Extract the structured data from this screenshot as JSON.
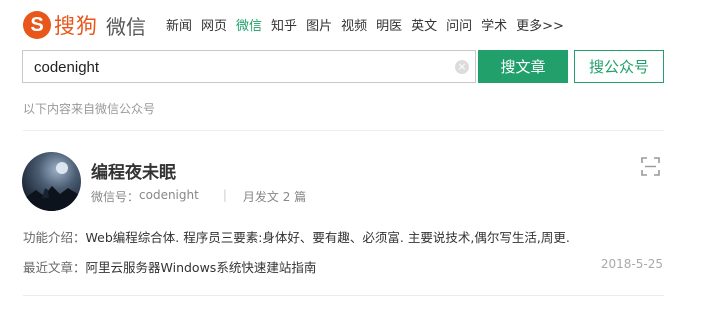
{
  "logo": {
    "mark": "S",
    "brand": "搜狗",
    "product": "微信"
  },
  "nav": [
    "新闻",
    "网页",
    "微信",
    "知乎",
    "图片",
    "视频",
    "明医",
    "英文",
    "问问",
    "学术",
    "更多>>"
  ],
  "nav_active": 2,
  "search": {
    "value": "codenight",
    "clear": "×"
  },
  "buttons": {
    "search_article": "搜文章",
    "search_account": "搜公众号"
  },
  "source_note": "以下内容来自微信公众号",
  "result": {
    "name": "编程夜未眠",
    "wechat_id_label": "微信号：",
    "wechat_id": "codenight",
    "monthly_posts": "月发文 2 篇",
    "intro_label": "功能介绍：",
    "intro": "Web编程综合体. 程序员三要素:身体好、要有趣、必须富. 主要说技术,偶尔写生活,周更.",
    "recent_label": "最近文章：",
    "recent_title": "阿里云服务器Windows系统快速建站指南",
    "recent_date": "2018-5-25"
  },
  "colors": {
    "accent": "#21a06b",
    "brand": "#e8561a"
  },
  "icons": {
    "qr": "qr-code-icon",
    "clear": "clear-icon"
  }
}
